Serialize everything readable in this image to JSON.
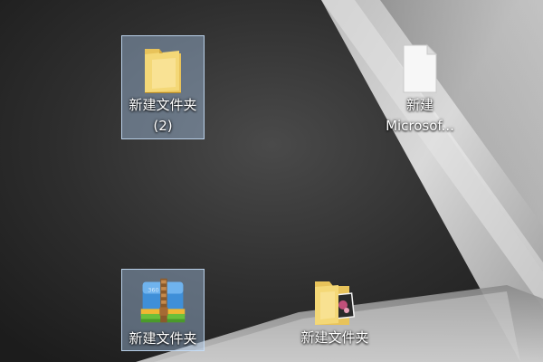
{
  "desktop": {
    "icons": [
      {
        "line1": "新建文件夹",
        "line2": "(2)",
        "icon": "folder-icon",
        "selected": true
      },
      {
        "line1": "新建",
        "line2": "Microsof...",
        "icon": "document-icon",
        "selected": false
      },
      {
        "line1": "新建文件夹",
        "icon": "zip-archive-icon",
        "selected": true
      },
      {
        "line1": "新建文件夹",
        "icon": "folder-with-photos-icon",
        "selected": false
      }
    ]
  },
  "colors": {
    "selection": "#a9c8eb",
    "folder": "#f2d56b",
    "label_text": "#ffffff"
  }
}
